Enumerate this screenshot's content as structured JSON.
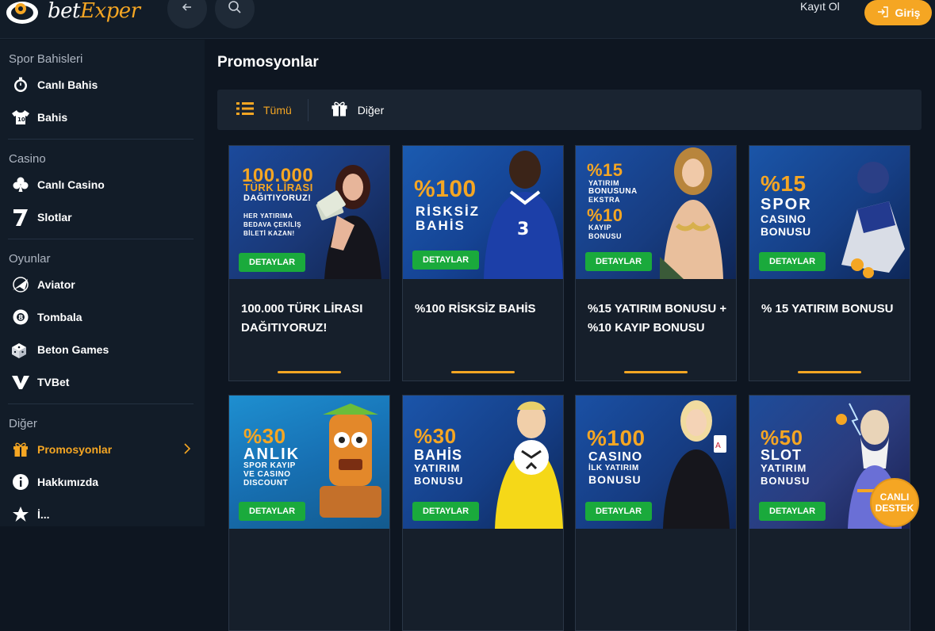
{
  "header": {
    "logo": {
      "text_a": "bet",
      "text_b": "Exper"
    },
    "back_icon": "arrow-left-icon",
    "search_icon": "search-icon",
    "register_label": "Kayıt Ol",
    "login_label": "Giriş",
    "accent": "#f5a623"
  },
  "sidebar": {
    "sections": [
      {
        "title": "Spor Bahisleri",
        "items": [
          {
            "label": "Canlı Bahis",
            "icon": "stopwatch-icon"
          },
          {
            "label": "Bahis",
            "icon": "jersey-icon"
          }
        ]
      },
      {
        "title": "Casino",
        "items": [
          {
            "label": "Canlı Casino",
            "icon": "club-icon"
          },
          {
            "label": "Slotlar",
            "icon": "seven-icon"
          }
        ]
      },
      {
        "title": "Oyunlar",
        "items": [
          {
            "label": "Aviator",
            "icon": "plane-icon"
          },
          {
            "label": "Tombala",
            "icon": "ball-icon"
          },
          {
            "label": "Beton Games",
            "icon": "dice-icon"
          },
          {
            "label": "TVBet",
            "icon": "v-icon"
          }
        ]
      },
      {
        "title": "Diğer",
        "items": [
          {
            "label": "Promosyonlar",
            "icon": "gift-icon",
            "active": true
          },
          {
            "label": "Hakkımızda",
            "icon": "info-icon"
          },
          {
            "label": "İ...",
            "icon": "star-icon"
          }
        ]
      }
    ]
  },
  "main": {
    "title": "Promosyonlar",
    "filters": [
      {
        "label": "Tümü",
        "icon": "list-icon",
        "active": true
      },
      {
        "label": "Diğer",
        "icon": "gift-icon",
        "active": false
      }
    ],
    "detail_label": "DETAYLAR",
    "cards": [
      {
        "title": "100.000 TÜRK LİRASI DAĞITIYORUZ!",
        "banner": [
          "100.000",
          "TÜRK LİRASI",
          "DAĞITIYORUZ!",
          "HER YATIRIMA",
          "BEDAVA ÇEKİLİŞ",
          "BİLETİ KAZAN!"
        ]
      },
      {
        "title": "%100 RİSKSİZ BAHİS",
        "banner": [
          "%100",
          "RİSKSİZ",
          "BAHİS"
        ]
      },
      {
        "title": "%15 YATIRIM BONUSU + %10 KAYIP BONUSU",
        "banner": [
          "%15",
          "YATIRIM",
          "BONUSUNA",
          "EKSTRA",
          "%10",
          "KAYIP",
          "BONUSU"
        ]
      },
      {
        "title": "% 15 YATIRIM BONUSU",
        "banner": [
          "%15",
          "SPOR",
          "CASINO",
          "BONUSU"
        ]
      },
      {
        "title": "",
        "banner": [
          "%30",
          "ANLIK",
          "SPOR KAYIP",
          "VE CASINO",
          "DISCOUNT"
        ]
      },
      {
        "title": "",
        "banner": [
          "%30",
          "BAHİS",
          "YATIRIM",
          "BONUSU"
        ]
      },
      {
        "title": "",
        "banner": [
          "%100",
          "CASINO",
          "İLK YATIRIM",
          "BONUSU"
        ]
      },
      {
        "title": "",
        "banner": [
          "%50",
          "SLOT",
          "YATIRIM",
          "BONUSU"
        ]
      }
    ]
  },
  "support": {
    "line1": "CANLI",
    "line2": "DESTEK"
  }
}
